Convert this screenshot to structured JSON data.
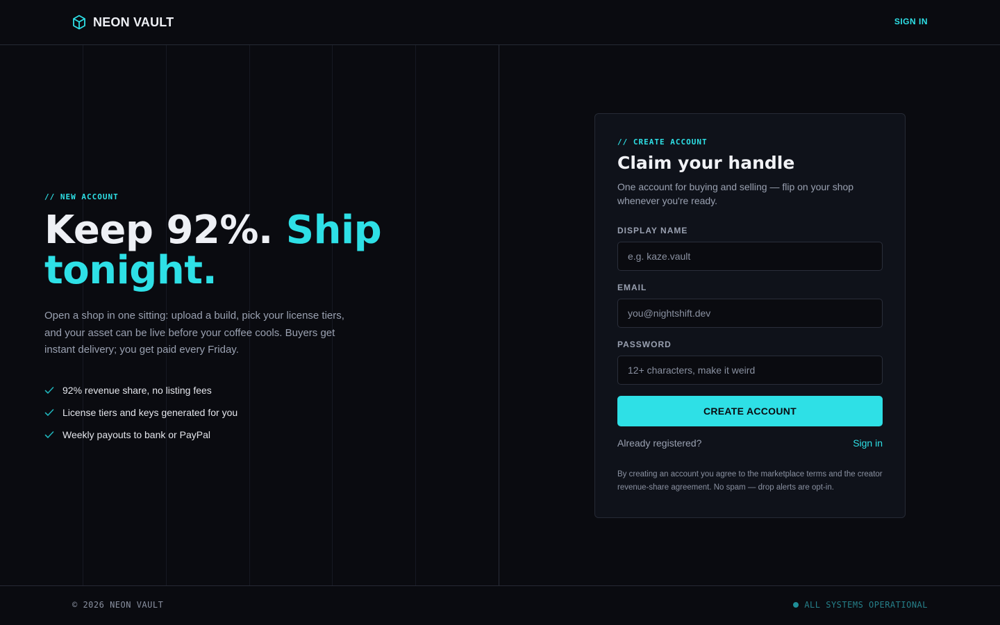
{
  "header": {
    "brand": "NEON VAULT",
    "brand_icon": "cube-icon",
    "signin_label": "SIGN IN"
  },
  "hero": {
    "kicker": "// NEW ACCOUNT",
    "title_part1": "Keep 92%. ",
    "title_part2": "Ship tonight.",
    "description": "Open a shop in one sitting: upload a build, pick your license tiers, and your asset can be live before your coffee cools. Buyers get instant delivery; you get paid every Friday.",
    "features": [
      "92% revenue share, no listing fees",
      "License tiers and keys generated for you",
      "Weekly payouts to bank or PayPal"
    ]
  },
  "form": {
    "kicker": "// CREATE ACCOUNT",
    "title": "Claim your handle",
    "subtitle": "One account for buying and selling — flip on your shop whenever you're ready.",
    "fields": [
      {
        "label": "DISPLAY NAME",
        "placeholder": "e.g. kaze.vault",
        "value": ""
      },
      {
        "label": "EMAIL",
        "placeholder": "you@nightshift.dev",
        "value": ""
      },
      {
        "label": "PASSWORD",
        "placeholder": "12+ characters, make it weird",
        "value": ""
      }
    ],
    "submit_label": "CREATE ACCOUNT",
    "already_text": "Already registered?",
    "signin_link": "Sign in",
    "legal": "By creating an account you agree to the marketplace terms and the creator revenue-share agreement. No spam — drop alerts are opt-in."
  },
  "footer": {
    "copyright": "© 2026 NEON VAULT",
    "status": "ALL SYSTEMS OPERATIONAL"
  },
  "colors": {
    "background": "#0a0b10",
    "card": "#0f121a",
    "accent": "#2ee0e6",
    "muted_text": "#9aa1b1",
    "status": "#1f8f98"
  }
}
